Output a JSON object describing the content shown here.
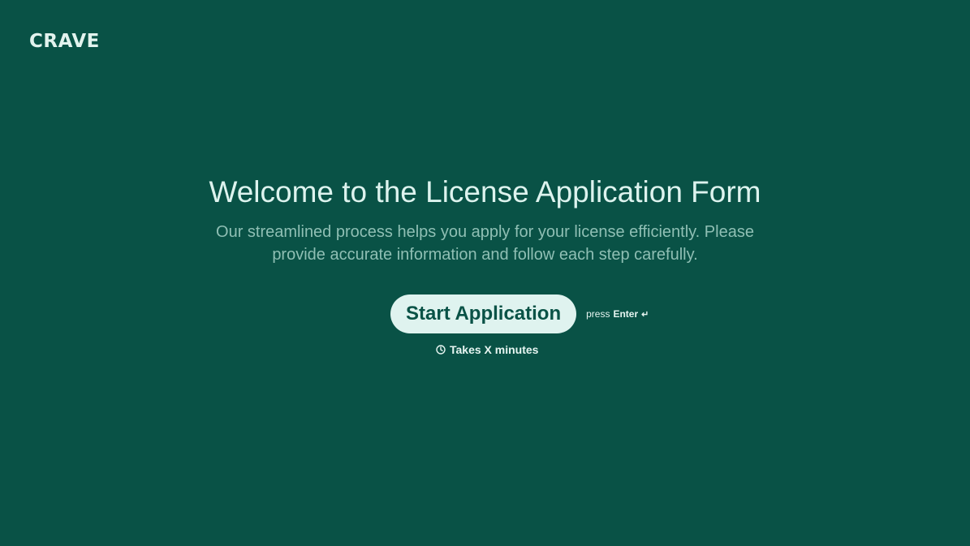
{
  "brand": {
    "logo_text": "CRAVE"
  },
  "hero": {
    "title": "Welcome to the License Application Form",
    "subtitle": "Our streamlined process helps you apply for your license efficiently. Please provide accurate information and follow each step carefully."
  },
  "cta": {
    "start_label": "Start Application",
    "hint_prefix": "press",
    "hint_key": "Enter",
    "hint_icon": "enter-icon"
  },
  "duration": {
    "icon": "clock-icon",
    "text": "Takes X minutes"
  },
  "colors": {
    "background": "#095246",
    "button_bg": "#dff3ef",
    "button_text": "#095246",
    "title": "#ddf3ee",
    "subtitle": "#8fbfb4"
  }
}
